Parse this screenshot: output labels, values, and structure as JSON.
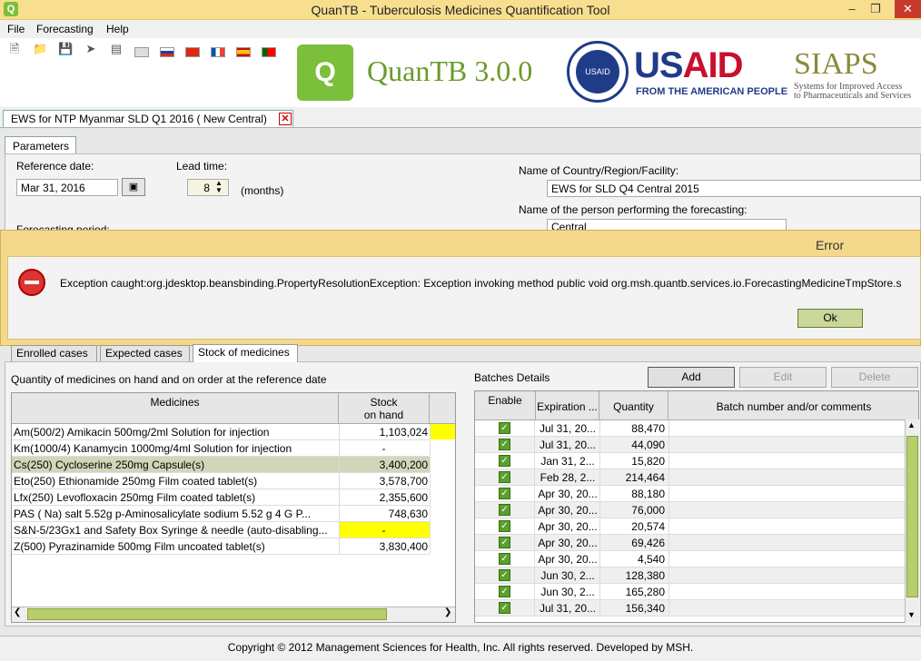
{
  "window": {
    "title": "QuanTB - Tuberculosis Medicines Quantification Tool",
    "icon": "app-logo-icon"
  },
  "menu": [
    "File",
    "Forecasting",
    "Help"
  ],
  "toolbar": {
    "icons": [
      "new-file-icon",
      "open-folder-icon",
      "save-icon",
      "go-icon",
      "report-icon",
      "english-flag-icon",
      "russian-flag-icon",
      "chinese-flag-icon",
      "french-flag-icon",
      "spanish-flag-icon",
      "portuguese-flag-icon"
    ]
  },
  "banner": {
    "logo_text": "QuanTB 3.0.0",
    "usaid_seal_text": "USAID",
    "usaid_us": "US",
    "usaid_aid": "AID",
    "usaid_sub": "FROM THE AMERICAN PEOPLE",
    "siaps": "SIAPS",
    "siaps_sub1": "Systems for Improved Access",
    "siaps_sub2": "to Pharmaceuticals and Services"
  },
  "doc_tab": {
    "label": "EWS for NTP Myanmar  SLD Q1 2016 (  New Central)",
    "close": "✕"
  },
  "params": {
    "tab": "Parameters",
    "reference_date_label": "Reference date:",
    "reference_date": "Mar 31, 2016",
    "lead_time_label": "Lead time:",
    "lead_time": "8",
    "lead_time_unit": "(months)",
    "forecasting_period_label": "Forecasting period:",
    "country_label": "Name of Country/Region/Facility:",
    "country_value": "EWS for SLD Q4 Central 2015",
    "person_label": "Name of the person performing the forecasting:",
    "person_value": "Central"
  },
  "error": {
    "title": "Error",
    "message": "Exception caught:org.jdesktop.beansbinding.PropertyResolutionException: Exception invoking method public void org.msh.quantb.services.io.ForecastingMedicineTmpStore.s",
    "ok": "Ok"
  },
  "subtabs": [
    "Enrolled cases",
    "Expected cases",
    "Stock of medicines"
  ],
  "stock": {
    "description": "Quantity of medicines on hand and on order at the reference date",
    "col_medicines": "Medicines",
    "col_stock_1": "Stock",
    "col_stock_2": "on hand",
    "rows": [
      {
        "medicine": "Am(500/2)  Amikacin  500mg/2ml  Solution for injection",
        "stock": "1,103,024"
      },
      {
        "medicine": "Km(1000/4)  Kanamycin  1000mg/4ml  Solution for injection",
        "stock": "-"
      },
      {
        "medicine": "Cs(250)  Cycloserine  250mg  Capsule(s)",
        "stock": "3,400,200"
      },
      {
        "medicine": "Eto(250)  Ethionamide  250mg  Film coated tablet(s)",
        "stock": "3,578,700"
      },
      {
        "medicine": "Lfx(250)  Levofloxacin  250mg  Film coated tablet(s)",
        "stock": "2,355,600"
      },
      {
        "medicine": "PAS ( Na) salt 5.52g    p-Aminosalicylate sodium 5.52 g   4 G P...",
        "stock": "748,630"
      },
      {
        "medicine": "S&N-5/23Gx1 and Safety Box   Syringe & needle (auto-disabling...",
        "stock": "-"
      },
      {
        "medicine": "Z(500)  Pyrazinamide  500mg  Film uncoated tablet(s)",
        "stock": "3,830,400"
      }
    ]
  },
  "batches": {
    "title": "Batches Details",
    "add": "Add",
    "edit": "Edit",
    "delete": "Delete",
    "col_enable": "Enable",
    "col_expiration": "Expiration ...",
    "col_quantity": "Quantity",
    "col_comments": "Batch number and/or comments",
    "check_mark": "✓",
    "rows": [
      {
        "expiration": "Jul 31, 20...",
        "quantity": "88,470"
      },
      {
        "expiration": "Jul 31, 20...",
        "quantity": "44,090"
      },
      {
        "expiration": "Jan 31, 2...",
        "quantity": "15,820"
      },
      {
        "expiration": "Feb 28, 2...",
        "quantity": "214,464"
      },
      {
        "expiration": "Apr 30, 20...",
        "quantity": "88,180"
      },
      {
        "expiration": "Apr 30, 20...",
        "quantity": "76,000"
      },
      {
        "expiration": "Apr 30, 20...",
        "quantity": "20,574"
      },
      {
        "expiration": "Apr 30, 20...",
        "quantity": "69,426"
      },
      {
        "expiration": "Apr 30, 20...",
        "quantity": "4,540"
      },
      {
        "expiration": "Jun 30, 2...",
        "quantity": "128,380"
      },
      {
        "expiration": "Jun 30, 2...",
        "quantity": "165,280"
      },
      {
        "expiration": "Jul 31, 20...",
        "quantity": "156,340"
      }
    ]
  },
  "footer": "Copyright © 2012 Management Sciences for Health, Inc. All rights reserved. Developed by MSH.",
  "colors": {
    "title_bar": "#f7df8f",
    "accent_green": "#7bbf3a",
    "usaid_blue": "#1f3c88",
    "usaid_red": "#c8102e",
    "highlight_yellow": "#ffff00"
  }
}
